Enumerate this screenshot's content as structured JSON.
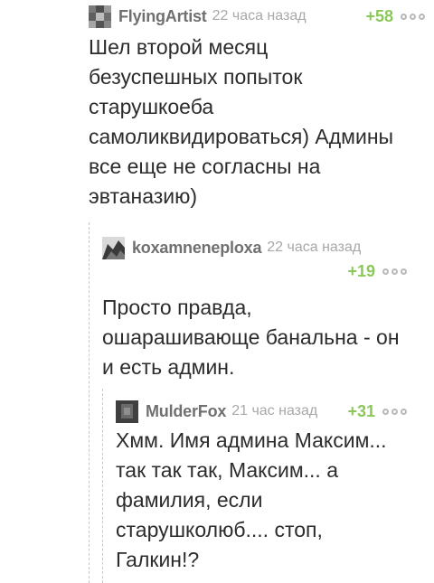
{
  "comments": [
    {
      "author": "FlyingArtist",
      "time": "22 часа назад",
      "score": "+58",
      "lines": [
        "Шел второй месяц",
        "безуспешных попыток",
        "старушкоеба",
        "самоликвидироваться) Админы",
        "все еще не согласны на",
        "эвтаназию)"
      ]
    },
    {
      "author": "koxamneneploxa",
      "time": "22 часа назад",
      "score": "+19",
      "lines": [
        "Просто правда,",
        "ошарашивающе банальна - он",
        "и есть админ."
      ]
    },
    {
      "author": "MulderFox",
      "time": "21 час назад",
      "score": "+31",
      "lines": [
        "Хмм. Имя админа Максим...",
        "так так так, Максим... а",
        "фамилия, если",
        "старушколюб.... стоп,",
        "Галкин!?"
      ]
    }
  ],
  "icons": {
    "more": "more-dots-icon"
  },
  "colors": {
    "score": "#8ac858",
    "author": "#707070",
    "time": "#a8a8a8"
  }
}
